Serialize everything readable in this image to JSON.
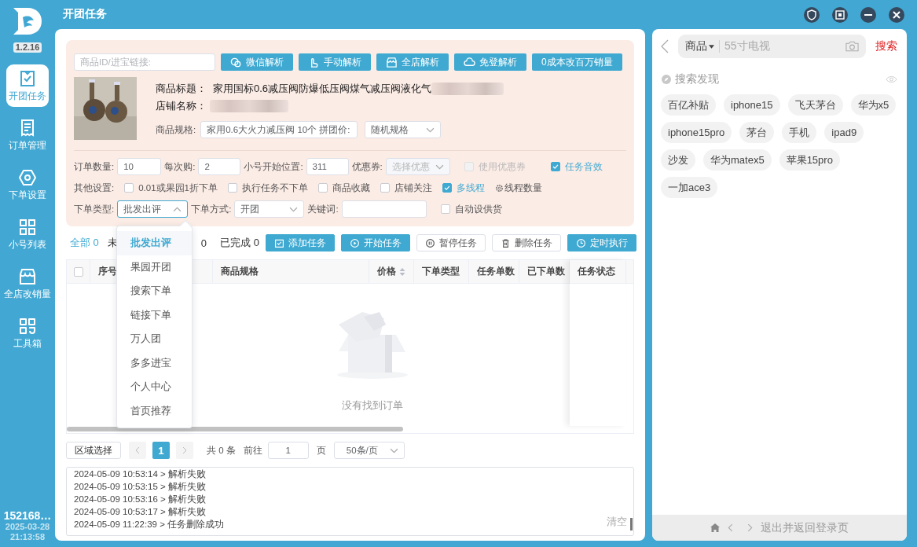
{
  "window": {
    "title": "开团任务"
  },
  "sidebar": {
    "version": "1.2.16",
    "items": [
      {
        "label": "开团任务",
        "selected": true
      },
      {
        "label": "订单管理",
        "selected": false
      },
      {
        "label": "下单设置",
        "selected": false
      },
      {
        "label": "小号列表",
        "selected": false
      },
      {
        "label": "全店改销量",
        "selected": false
      },
      {
        "label": "工具箱",
        "selected": false
      }
    ],
    "account": "152168…",
    "date": "2025-03-28",
    "time": "21:13:58"
  },
  "parse_bar": {
    "placeholder": "商品ID/进宝链接:",
    "buttons": [
      "微信解析",
      "手动解析",
      "全店解析",
      "免登解析",
      "0成本改百万销量"
    ]
  },
  "product": {
    "title_label": "商品标题：",
    "title": "家用国标0.6减压阀防爆低压阀煤气减压阀液化气",
    "store_label": "店铺名称：",
    "spec_label": "商品规格:",
    "spec_value": "家用0.6大火力减压阀 10个 拼团价:",
    "spec_mode": "随机规格"
  },
  "settings": {
    "quantity_label": "订单数量:",
    "quantity": "10",
    "per_buy_label": "每次购:",
    "per_buy": "2",
    "start_label": "小号开始位置:",
    "start": "311",
    "coupon_label": "优惠券:",
    "coupon_value": "选择优惠",
    "row1_checks": [
      {
        "label": "使用优惠券",
        "checked": false,
        "disabled": true
      },
      {
        "label": "任务音效",
        "checked": true,
        "disabled": false
      }
    ],
    "other_label": "其他设置:",
    "other_checks": [
      {
        "label": "0.01或果园1折下单",
        "checked": false
      },
      {
        "label": "执行任务不下单",
        "checked": false
      },
      {
        "label": "商品收藏",
        "checked": false
      },
      {
        "label": "店铺关注",
        "checked": false
      },
      {
        "label": "多线程",
        "checked": true
      }
    ],
    "thread_label": "线程数量",
    "type_label": "下单类型:",
    "type_value": "批发出评",
    "type_expanded": true,
    "mode_label": "下单方式:",
    "mode_value": "开团",
    "keyword_label": "关键词:",
    "auto_check": {
      "label": "自动设供货",
      "checked": false
    }
  },
  "type_menu": [
    {
      "label": "批发出评",
      "selected": true
    },
    {
      "label": "果园开团",
      "selected": false
    },
    {
      "label": "搜索下单",
      "selected": false
    },
    {
      "label": "链接下单",
      "selected": false
    },
    {
      "label": "万人团",
      "selected": false
    },
    {
      "label": "多多进宝",
      "selected": false
    },
    {
      "label": "个人中心",
      "selected": false
    },
    {
      "label": "首页推荐",
      "selected": false
    }
  ],
  "tabs": [
    {
      "label": "全部 0",
      "selected": true
    },
    {
      "label": "未",
      "count": "0",
      "selected": false
    },
    {
      "label": "已完成 0",
      "selected": false
    }
  ],
  "actions": [
    {
      "label": "添加任务",
      "kind": "primary"
    },
    {
      "label": "开始任务",
      "kind": "primary"
    },
    {
      "label": "暂停任务",
      "kind": "plain"
    },
    {
      "label": "删除任务",
      "kind": "plain"
    },
    {
      "label": "定时执行",
      "kind": "primary"
    }
  ],
  "table": {
    "select_all": {
      "checked": false
    },
    "columns": [
      "序号",
      "商品规格",
      "价格",
      "下单类型",
      "任务单数",
      "已下单数",
      "任务状态"
    ],
    "empty_text": "没有找到订单"
  },
  "pagination": {
    "region_button": "区域选择",
    "current": "1",
    "total": "共 0 条",
    "goto_label": "前往",
    "goto_value": "1",
    "page_label": "页",
    "page_size": "50条/页"
  },
  "log": {
    "lines": [
      "2024-05-09 10:53:14 > 解析失败",
      "2024-05-09 10:53:15 > 解析失败",
      "2024-05-09 10:53:16 > 解析失败",
      "2024-05-09 10:53:17 > 解析失败",
      "2024-05-09 11:22:39 > 任务删除成功"
    ],
    "clear": "清空"
  },
  "search_panel": {
    "category": "商品",
    "placeholder": "55寸电视",
    "search_button": "搜索",
    "discover_title": "搜索发现",
    "tags": [
      "百亿补贴",
      "iphone15",
      "飞天茅台",
      "华为x5",
      "iphone15pro",
      "茅台",
      "手机",
      "ipad9",
      "沙发",
      "华为matex5",
      "苹果15pro",
      "一加ace3"
    ],
    "footer_link": "退出并返回登录页"
  }
}
